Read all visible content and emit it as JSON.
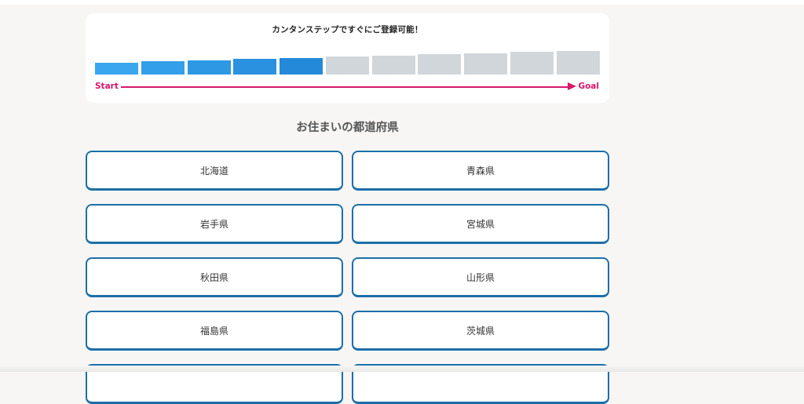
{
  "progress": {
    "title": "カンタンステップですぐにご登録可能！",
    "start_label": "Start",
    "goal_label": "Goal",
    "total_steps": 11,
    "completed_steps": 5,
    "active_colors": [
      "#3aa6ef",
      "#339fea",
      "#2e98e4",
      "#2991df",
      "#2589da"
    ],
    "inactive_color": "#d1d6db",
    "accent_color": "#d6176c"
  },
  "section": {
    "title": "お住まいの都道府県"
  },
  "prefectures": [
    {
      "label": "北海道"
    },
    {
      "label": "青森県"
    },
    {
      "label": "岩手県"
    },
    {
      "label": "宮城県"
    },
    {
      "label": "秋田県"
    },
    {
      "label": "山形県"
    },
    {
      "label": "福島県"
    },
    {
      "label": "茨城県"
    },
    {
      "label": ""
    },
    {
      "label": ""
    }
  ]
}
